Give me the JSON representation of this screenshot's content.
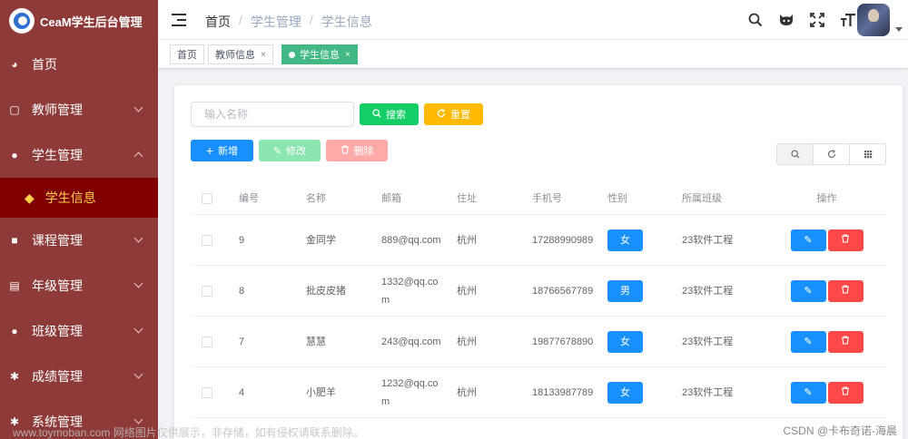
{
  "app": {
    "title": "CeaM学生后台管理"
  },
  "sidebar": {
    "items": [
      {
        "label": "首页",
        "icon": "dashboard-icon",
        "glyph": "◕",
        "expandable": false
      },
      {
        "label": "教师管理",
        "icon": "teacher-icon",
        "glyph": "▢",
        "expandable": true
      },
      {
        "label": "学生管理",
        "icon": "user-icon",
        "glyph": "●",
        "expandable": true,
        "expanded": true,
        "children": [
          {
            "label": "学生信息",
            "icon": "eye-icon",
            "glyph": "◆",
            "active": true
          }
        ]
      },
      {
        "label": "课程管理",
        "icon": "lock-icon",
        "glyph": "■",
        "expandable": true
      },
      {
        "label": "年级管理",
        "icon": "grade-icon",
        "glyph": "▤",
        "expandable": true
      },
      {
        "label": "班级管理",
        "icon": "wechat-icon",
        "glyph": "●",
        "expandable": true
      },
      {
        "label": "成绩管理",
        "icon": "gear-icon",
        "glyph": "✱",
        "expandable": true
      },
      {
        "label": "系统管理",
        "icon": "settings-icon",
        "glyph": "✱",
        "expandable": true
      }
    ]
  },
  "header": {
    "breadcrumb": [
      "首页",
      "学生管理",
      "学生信息"
    ],
    "icons": [
      "search-icon",
      "github-icon",
      "fullscreen-icon",
      "font-size-icon"
    ]
  },
  "tags": [
    {
      "label": "首页",
      "closable": false,
      "active": false
    },
    {
      "label": "教师信息",
      "closable": true,
      "active": false
    },
    {
      "label": "学生信息",
      "closable": true,
      "active": true
    }
  ],
  "toolbar": {
    "search_placeholder": "输入名称",
    "search_label": "搜索",
    "reset_label": "重置",
    "add_label": "新增",
    "edit_label": "修改",
    "delete_label": "删除"
  },
  "table": {
    "headers": [
      "编号",
      "名称",
      "邮箱",
      "住址",
      "手机号",
      "性别",
      "所属班级",
      "操作"
    ],
    "rows": [
      {
        "id": "9",
        "name": "金同学",
        "email": "889@qq.com",
        "address": "杭州",
        "phone": "17288990989",
        "gender": "女",
        "class": "23软件工程"
      },
      {
        "id": "8",
        "name": "批皮皮猪",
        "email": "1332@qq.com",
        "address": "杭州",
        "phone": "18766567789",
        "gender": "男",
        "class": "23软件工程"
      },
      {
        "id": "7",
        "name": "慧慧",
        "email": "243@qq.com",
        "address": "杭州",
        "phone": "19877678890",
        "gender": "女",
        "class": "23软件工程"
      },
      {
        "id": "4",
        "name": "小肥羊",
        "email": "1232@qq.com",
        "address": "杭州",
        "phone": "18133987789",
        "gender": "女",
        "class": "23软件工程"
      }
    ]
  },
  "watermark": {
    "left": "www.toymoban.com 网络图片仅供展示，非存储，如有侵权请联系删除。",
    "right": "CSDN @卡布奇诺-海晨"
  },
  "colors": {
    "sidebar_bg": "#8e3a38",
    "active_submenu_bg": "#800000",
    "active_text": "#ffd04b",
    "primary": "#1890ff",
    "success": "#13ce66",
    "warning": "#ffba00",
    "danger": "#ff4949",
    "tag_active": "#42b983"
  }
}
